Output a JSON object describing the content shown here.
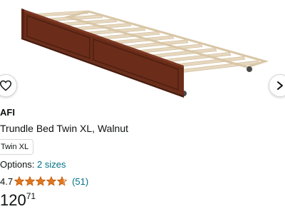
{
  "product": {
    "brand": "AFI",
    "title": "Trundle Bed Twin XL, Walnut",
    "size_chip": "Twin XL",
    "options_label": "Options:",
    "options_link": "2 sizes",
    "rating_text": "4.7",
    "rating_value": 4.7,
    "rating_max": 5,
    "review_count": "(51)",
    "price_whole": "120",
    "price_fraction": "71"
  },
  "icons": {
    "wishlist": "heart-icon",
    "next": "chevron-right-icon",
    "star": "star-icon"
  },
  "colors": {
    "link": "#007185",
    "star": "#de7921",
    "wood": "#6b2d1a",
    "slats": "#e6d7bf"
  }
}
